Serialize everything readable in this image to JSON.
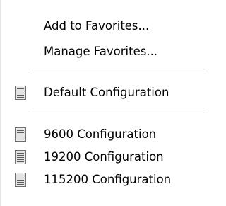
{
  "menu": {
    "favorites": {
      "add_label": "Add to Favorites...",
      "manage_label": "Manage Favorites..."
    },
    "default_config": {
      "label": "Default Configuration",
      "icon": "document-list-icon"
    },
    "configs": [
      {
        "label": "9600 Configuration",
        "icon": "document-list-icon"
      },
      {
        "label": "19200 Configuration",
        "icon": "document-list-icon"
      },
      {
        "label": "115200 Configuration",
        "icon": "document-list-icon"
      }
    ]
  }
}
